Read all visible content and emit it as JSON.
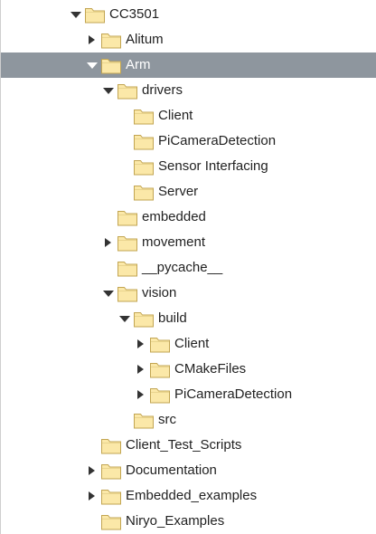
{
  "tree": {
    "folder_fill": "#fbe8a8",
    "folder_stroke": "#c2a552",
    "selection_color": "#8e969e",
    "items": [
      {
        "label": "CC3501",
        "depth": 0,
        "state": "expanded",
        "selected": false
      },
      {
        "label": "Alitum",
        "depth": 1,
        "state": "collapsed",
        "selected": false
      },
      {
        "label": "Arm",
        "depth": 1,
        "state": "expanded",
        "selected": true
      },
      {
        "label": "drivers",
        "depth": 2,
        "state": "expanded",
        "selected": false
      },
      {
        "label": "Client",
        "depth": 3,
        "state": "none",
        "selected": false
      },
      {
        "label": "PiCameraDetection",
        "depth": 3,
        "state": "none",
        "selected": false
      },
      {
        "label": "Sensor Interfacing",
        "depth": 3,
        "state": "none",
        "selected": false
      },
      {
        "label": "Server",
        "depth": 3,
        "state": "none",
        "selected": false
      },
      {
        "label": "embedded",
        "depth": 2,
        "state": "none",
        "selected": false
      },
      {
        "label": "movement",
        "depth": 2,
        "state": "collapsed",
        "selected": false
      },
      {
        "label": "__pycache__",
        "depth": 2,
        "state": "none",
        "selected": false
      },
      {
        "label": "vision",
        "depth": 2,
        "state": "expanded",
        "selected": false
      },
      {
        "label": "build",
        "depth": 3,
        "state": "expanded",
        "selected": false
      },
      {
        "label": "Client",
        "depth": 4,
        "state": "collapsed",
        "selected": false
      },
      {
        "label": "CMakeFiles",
        "depth": 4,
        "state": "collapsed",
        "selected": false
      },
      {
        "label": "PiCameraDetection",
        "depth": 4,
        "state": "collapsed",
        "selected": false
      },
      {
        "label": "src",
        "depth": 3,
        "state": "none",
        "selected": false
      },
      {
        "label": "Client_Test_Scripts",
        "depth": 1,
        "state": "none",
        "selected": false
      },
      {
        "label": "Documentation",
        "depth": 1,
        "state": "collapsed",
        "selected": false
      },
      {
        "label": "Embedded_examples",
        "depth": 1,
        "state": "collapsed",
        "selected": false
      },
      {
        "label": "Niryo_Examples",
        "depth": 1,
        "state": "none",
        "selected": false
      }
    ]
  }
}
